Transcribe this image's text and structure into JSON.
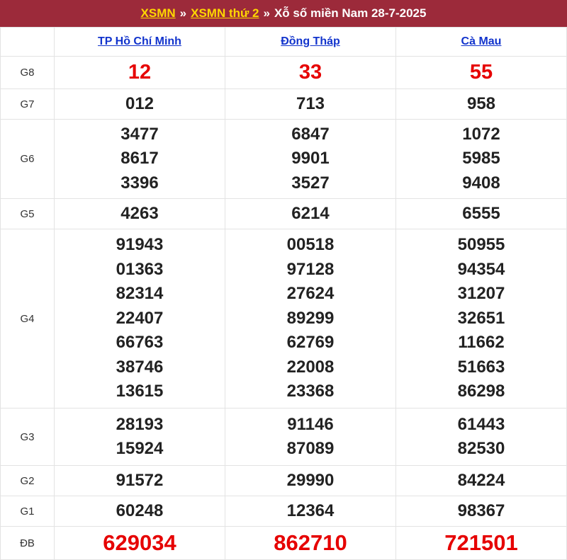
{
  "header": {
    "link1": "XSMN",
    "sep1": "»",
    "link2": "XSMN thứ 2",
    "sep2": "»",
    "title": "Xỗ số miền Nam 28-7-2025"
  },
  "provinces": [
    "TP Hồ Chí Minh",
    "Đồng Tháp",
    "Cà Mau"
  ],
  "prizes": [
    {
      "label": "G8",
      "values": [
        [
          "12"
        ],
        [
          "33"
        ],
        [
          "55"
        ]
      ]
    },
    {
      "label": "G7",
      "values": [
        [
          "012"
        ],
        [
          "713"
        ],
        [
          "958"
        ]
      ]
    },
    {
      "label": "G6",
      "values": [
        [
          "3477",
          "8617",
          "3396"
        ],
        [
          "6847",
          "9901",
          "3527"
        ],
        [
          "1072",
          "5985",
          "9408"
        ]
      ]
    },
    {
      "label": "G5",
      "values": [
        [
          "4263"
        ],
        [
          "6214"
        ],
        [
          "6555"
        ]
      ]
    },
    {
      "label": "G4",
      "values": [
        [
          "91943",
          "01363",
          "82314",
          "22407",
          "66763",
          "38746",
          "13615"
        ],
        [
          "00518",
          "97128",
          "27624",
          "89299",
          "62769",
          "22008",
          "23368"
        ],
        [
          "50955",
          "94354",
          "31207",
          "32651",
          "11662",
          "51663",
          "86298"
        ]
      ]
    },
    {
      "label": "G3",
      "values": [
        [
          "28193",
          "15924"
        ],
        [
          "91146",
          "87089"
        ],
        [
          "61443",
          "82530"
        ]
      ]
    },
    {
      "label": "G2",
      "values": [
        [
          "91572"
        ],
        [
          "29990"
        ],
        [
          "84224"
        ]
      ]
    },
    {
      "label": "G1",
      "values": [
        [
          "60248"
        ],
        [
          "12364"
        ],
        [
          "98367"
        ]
      ]
    },
    {
      "label": "ĐB",
      "values": [
        [
          "629034"
        ],
        [
          "862710"
        ],
        [
          "721501"
        ]
      ]
    }
  ],
  "colors": {
    "header_bg": "#9c2a3a",
    "header_link": "#ffd800",
    "special": "#e60000",
    "province_link": "#1133cc"
  }
}
